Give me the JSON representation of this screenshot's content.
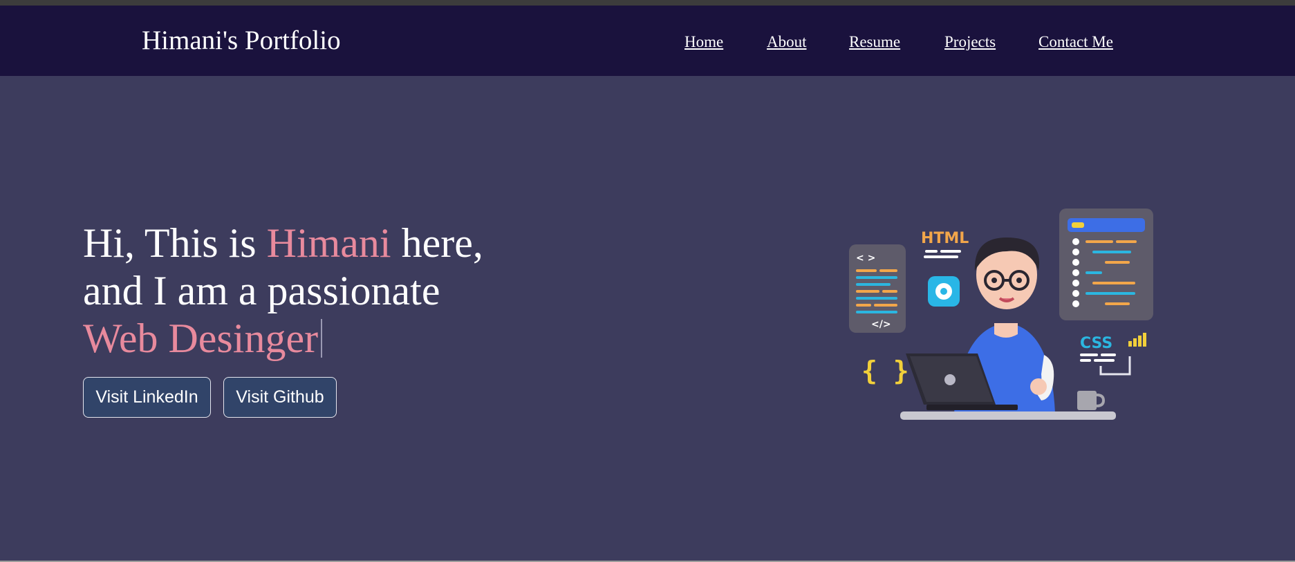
{
  "header": {
    "brand": "Himani's Portfolio",
    "nav": [
      {
        "label": "Home"
      },
      {
        "label": "About"
      },
      {
        "label": "Resume"
      },
      {
        "label": "Projects"
      },
      {
        "label": "Contact Me"
      }
    ]
  },
  "hero": {
    "line1_pre": "Hi, This is ",
    "name": "Himani",
    "line1_post": " here,",
    "line2": "and I am a passionate",
    "role": "Web Desinger",
    "buttons": {
      "linkedin": "Visit LinkedIn",
      "github": "Visit Github"
    }
  },
  "illustration": {
    "html_label": "HTML",
    "css_label": "CSS",
    "braces": "{ }",
    "tag_open": "< >",
    "tag_close": "</>"
  },
  "colors": {
    "background": "#3d3c5d",
    "navbar": "#1a123d",
    "accent": "#e88a9d",
    "button": "#314469"
  },
  "icons": [
    "developer-illustration",
    "gear-icon",
    "braces-icon",
    "code-tag-icon",
    "laptop-icon",
    "mug-icon",
    "signal-bars-icon"
  ]
}
